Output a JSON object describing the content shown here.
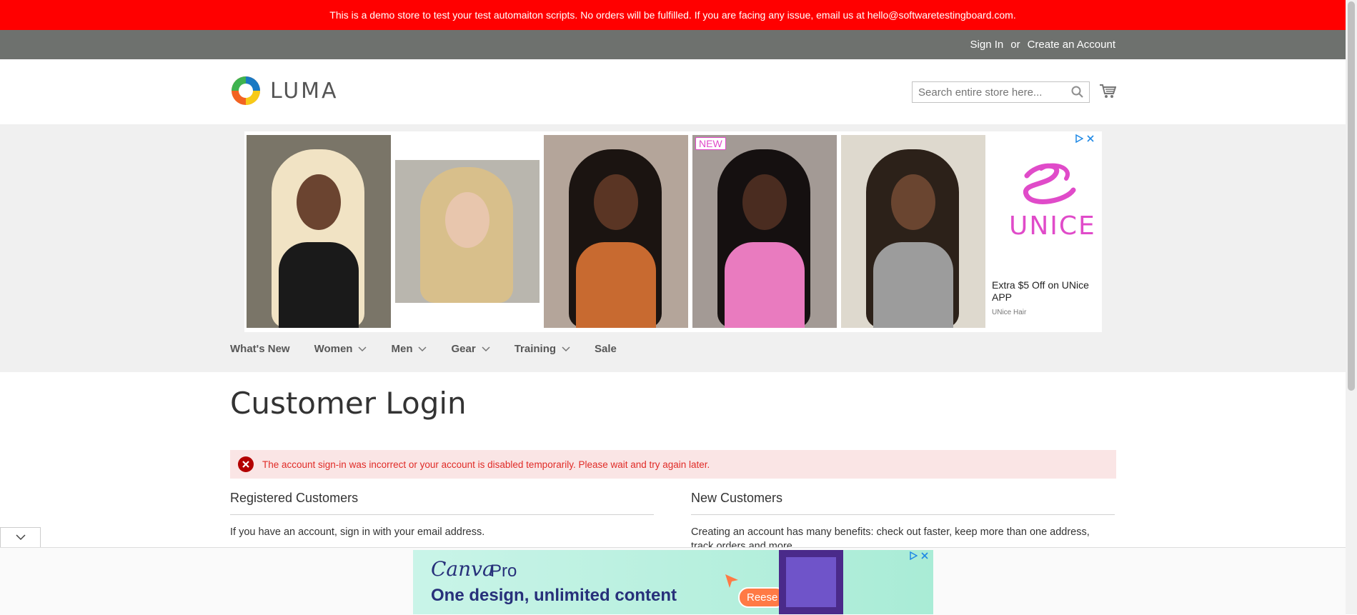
{
  "demo_banner": {
    "text": "This is a demo store to test your test automaiton scripts. No orders will be fulfilled. If you are facing any issue, email us at hello@softwaretestingboard.com."
  },
  "header_links": {
    "sign_in": "Sign In",
    "or": "or",
    "create_account": "Create an Account"
  },
  "logo": {
    "text": "LUMA"
  },
  "search": {
    "placeholder": "Search entire store here...",
    "value": ""
  },
  "ad_top": {
    "badge": "NEW",
    "brand": "UNICE",
    "headline": "Extra $5 Off on UNice APP",
    "advertiser": "UNice Hair",
    "colors": {
      "brand": "#e04bc9"
    }
  },
  "nav": {
    "items": [
      {
        "label": "What's New",
        "dropdown": false
      },
      {
        "label": "Women",
        "dropdown": true
      },
      {
        "label": "Men",
        "dropdown": true
      },
      {
        "label": "Gear",
        "dropdown": true
      },
      {
        "label": "Training",
        "dropdown": true
      },
      {
        "label": "Sale",
        "dropdown": false
      }
    ]
  },
  "page": {
    "title": "Customer Login",
    "error": "The account sign-in was incorrect or your account is disabled temporarily. Please wait and try again later."
  },
  "registered": {
    "heading": "Registered Customers",
    "text": "If you have an account, sign in with your email address."
  },
  "new_customers": {
    "heading": "New Customers",
    "text": "Creating an account has many benefits: check out faster, keep more than one address, track orders and more."
  },
  "bottom_ad": {
    "brand": "Canva",
    "pro": "Pro",
    "tagline": "One design, unlimited content",
    "cta": "Reese"
  },
  "colors": {
    "banner": "#ff0000",
    "panel": "#6e716e",
    "error_bg": "#fae5e5",
    "error_text": "#e02b27"
  }
}
